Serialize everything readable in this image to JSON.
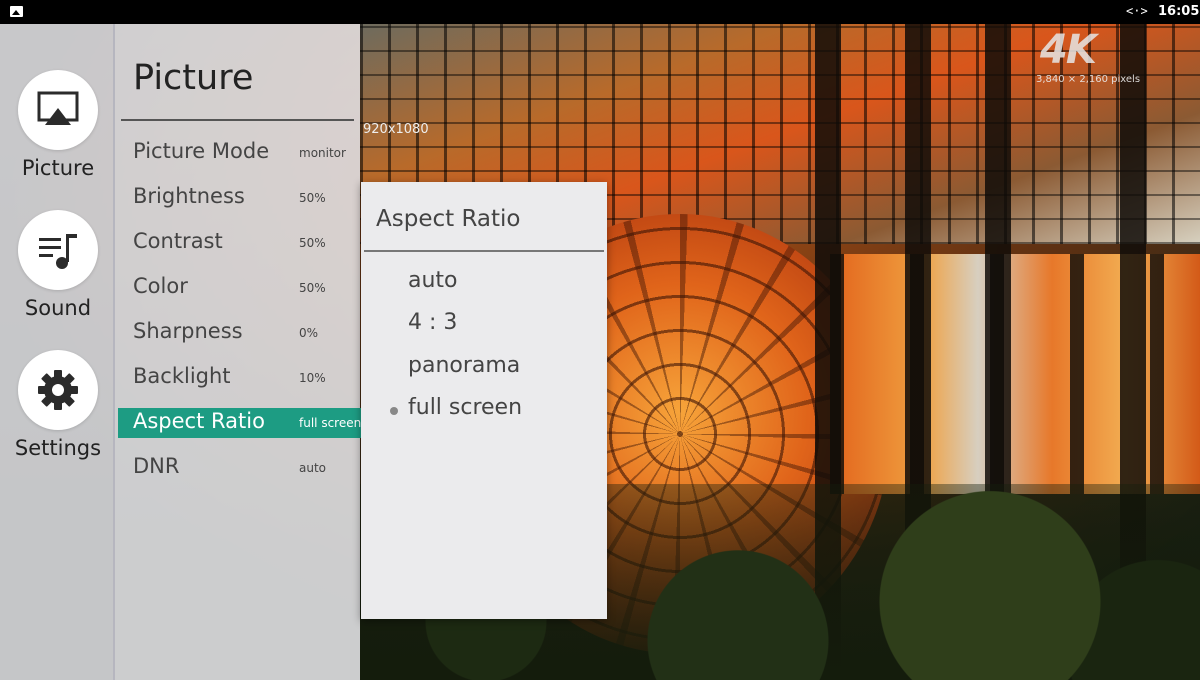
{
  "status_bar": {
    "time": "16:05",
    "left_icon": "gallery-icon",
    "right_icon": "code-icon"
  },
  "overlay": {
    "badge": "4K",
    "badge_dims": "3,840 × 2,160 pixels",
    "video_info": "920x1080"
  },
  "sidebar": {
    "items": [
      {
        "label": "Picture",
        "icon": "airplay-icon"
      },
      {
        "label": "Sound",
        "icon": "music-playlist-icon"
      },
      {
        "label": "Settings",
        "icon": "gear-icon"
      }
    ]
  },
  "picture_menu": {
    "title": "Picture",
    "items": [
      {
        "name": "Picture Mode",
        "value": "monitor"
      },
      {
        "name": "Brightness",
        "value": "50%"
      },
      {
        "name": "Contrast",
        "value": "50%"
      },
      {
        "name": "Color",
        "value": "50%"
      },
      {
        "name": "Sharpness",
        "value": "0%"
      },
      {
        "name": "Backlight",
        "value": "10%"
      },
      {
        "name": "Aspect Ratio",
        "value": "full screen"
      },
      {
        "name": "DNR",
        "value": "auto"
      }
    ],
    "selected_index": 6
  },
  "aspect_popup": {
    "title": "Aspect Ratio",
    "options": [
      "auto",
      "4 : 3",
      "panorama",
      "full screen"
    ],
    "selected": "full screen"
  },
  "colors": {
    "accent": "#1d9c83",
    "panel_bg": "#ececf0",
    "text": "#444444"
  }
}
